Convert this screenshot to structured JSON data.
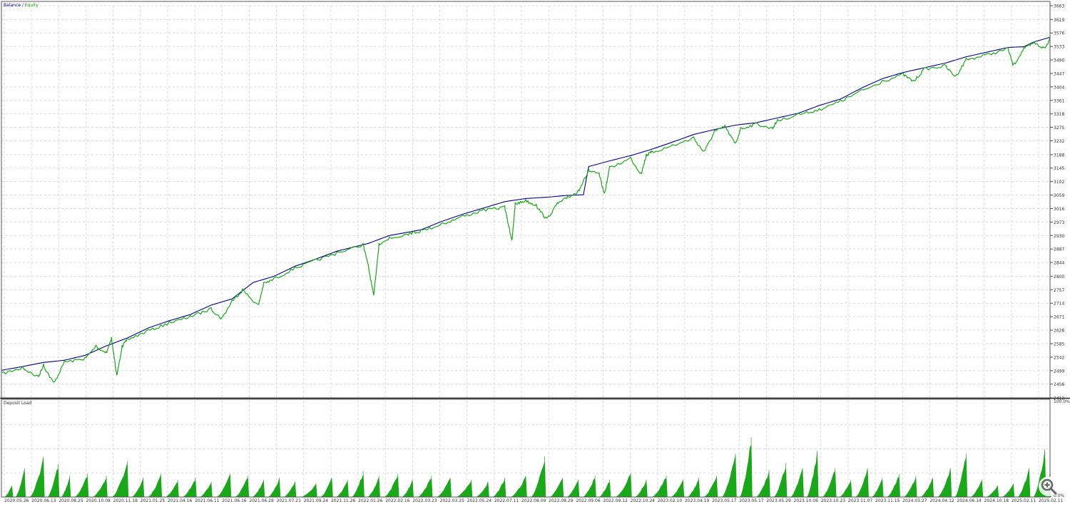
{
  "chart_data": [
    {
      "type": "line",
      "title": "Balance / Equity",
      "legend": [
        {
          "name": "Balance",
          "color": "#00008b"
        },
        {
          "name": "Equity",
          "color": "#18a818"
        }
      ],
      "separator": " / ",
      "ylim": [
        2412,
        3663
      ],
      "y_ticks": [
        3663,
        3619,
        3576,
        3533,
        3490,
        3447,
        3404,
        3361,
        3318,
        3275,
        3232,
        3188,
        3145,
        3102,
        3059,
        3016,
        2973,
        2930,
        2887,
        2844,
        2800,
        2757,
        2714,
        2671,
        2628,
        2585,
        2542,
        2499,
        2456,
        2412
      ],
      "grid": true,
      "series": [
        {
          "name": "Balance",
          "color": "#00008b",
          "points": [
            [
              0,
              2500
            ],
            [
              0.02,
              2512
            ],
            [
              0.04,
              2525
            ],
            [
              0.06,
              2532
            ],
            [
              0.08,
              2548
            ],
            [
              0.1,
              2578
            ],
            [
              0.12,
              2603
            ],
            [
              0.14,
              2635
            ],
            [
              0.16,
              2658
            ],
            [
              0.18,
              2678
            ],
            [
              0.2,
              2708
            ],
            [
              0.22,
              2728
            ],
            [
              0.24,
              2780
            ],
            [
              0.26,
              2800
            ],
            [
              0.28,
              2832
            ],
            [
              0.3,
              2855
            ],
            [
              0.32,
              2880
            ],
            [
              0.35,
              2905
            ],
            [
              0.37,
              2930
            ],
            [
              0.4,
              2948
            ],
            [
              0.42,
              2975
            ],
            [
              0.44,
              2998
            ],
            [
              0.46,
              3018
            ],
            [
              0.48,
              3038
            ],
            [
              0.5,
              3048
            ],
            [
              0.52,
              3052
            ],
            [
              0.54,
              3058
            ],
            [
              0.555,
              3060
            ],
            [
              0.56,
              3150
            ],
            [
              0.58,
              3168
            ],
            [
              0.6,
              3185
            ],
            [
              0.62,
              3205
            ],
            [
              0.64,
              3228
            ],
            [
              0.66,
              3252
            ],
            [
              0.68,
              3268
            ],
            [
              0.7,
              3282
            ],
            [
              0.72,
              3290
            ],
            [
              0.74,
              3305
            ],
            [
              0.76,
              3320
            ],
            [
              0.78,
              3345
            ],
            [
              0.8,
              3365
            ],
            [
              0.82,
              3400
            ],
            [
              0.84,
              3430
            ],
            [
              0.86,
              3450
            ],
            [
              0.88,
              3465
            ],
            [
              0.9,
              3480
            ],
            [
              0.92,
              3500
            ],
            [
              0.94,
              3515
            ],
            [
              0.96,
              3530
            ],
            [
              0.975,
              3532
            ],
            [
              0.985,
              3548
            ],
            [
              1.0,
              3562
            ]
          ]
        },
        {
          "name": "Equity",
          "color": "#18a818",
          "points": [
            [
              0,
              2493
            ],
            [
              0.02,
              2512
            ],
            [
              0.035,
              2482
            ],
            [
              0.04,
              2520
            ],
            [
              0.05,
              2462
            ],
            [
              0.06,
              2530
            ],
            [
              0.08,
              2542
            ],
            [
              0.09,
              2580
            ],
            [
              0.1,
              2560
            ],
            [
              0.105,
              2605
            ],
            [
              0.11,
              2485
            ],
            [
              0.115,
              2580
            ],
            [
              0.12,
              2602
            ],
            [
              0.14,
              2630
            ],
            [
              0.16,
              2655
            ],
            [
              0.18,
              2675
            ],
            [
              0.2,
              2700
            ],
            [
              0.21,
              2668
            ],
            [
              0.22,
              2725
            ],
            [
              0.23,
              2760
            ],
            [
              0.245,
              2710
            ],
            [
              0.25,
              2780
            ],
            [
              0.26,
              2795
            ],
            [
              0.28,
              2830
            ],
            [
              0.3,
              2855
            ],
            [
              0.32,
              2878
            ],
            [
              0.345,
              2905
            ],
            [
              0.35,
              2835
            ],
            [
              0.355,
              2740
            ],
            [
              0.36,
              2905
            ],
            [
              0.37,
              2925
            ],
            [
              0.39,
              2942
            ],
            [
              0.4,
              2948
            ],
            [
              0.42,
              2970
            ],
            [
              0.44,
              2995
            ],
            [
              0.46,
              3015
            ],
            [
              0.48,
              3025
            ],
            [
              0.484,
              2960
            ],
            [
              0.487,
              2918
            ],
            [
              0.49,
              3035
            ],
            [
              0.5,
              3045
            ],
            [
              0.51,
              3030
            ],
            [
              0.52,
              2985
            ],
            [
              0.53,
              3035
            ],
            [
              0.54,
              3055
            ],
            [
              0.55,
              3075
            ],
            [
              0.56,
              3140
            ],
            [
              0.57,
              3130
            ],
            [
              0.575,
              3065
            ],
            [
              0.58,
              3150
            ],
            [
              0.6,
              3180
            ],
            [
              0.61,
              3130
            ],
            [
              0.615,
              3190
            ],
            [
              0.62,
              3200
            ],
            [
              0.64,
              3220
            ],
            [
              0.66,
              3245
            ],
            [
              0.67,
              3200
            ],
            [
              0.68,
              3265
            ],
            [
              0.69,
              3282
            ],
            [
              0.7,
              3225
            ],
            [
              0.705,
              3275
            ],
            [
              0.72,
              3290
            ],
            [
              0.735,
              3275
            ],
            [
              0.74,
              3300
            ],
            [
              0.76,
              3320
            ],
            [
              0.78,
              3335
            ],
            [
              0.8,
              3362
            ],
            [
              0.82,
              3395
            ],
            [
              0.84,
              3425
            ],
            [
              0.86,
              3448
            ],
            [
              0.87,
              3425
            ],
            [
              0.88,
              3465
            ],
            [
              0.9,
              3475
            ],
            [
              0.91,
              3440
            ],
            [
              0.92,
              3495
            ],
            [
              0.94,
              3510
            ],
            [
              0.96,
              3530
            ],
            [
              0.965,
              3475
            ],
            [
              0.975,
              3530
            ],
            [
              0.985,
              3548
            ],
            [
              0.995,
              3530
            ],
            [
              1.0,
              3562
            ]
          ]
        }
      ]
    },
    {
      "type": "area",
      "title": "Deposit Load",
      "ylim": [
        0,
        100
      ],
      "y_top_label": "100.0%",
      "y_bottom_label": "0.0%",
      "color": "#18a818",
      "peaks": [
        [
          0.01,
          12
        ],
        [
          0.022,
          30
        ],
        [
          0.04,
          42
        ],
        [
          0.054,
          34
        ],
        [
          0.065,
          22
        ],
        [
          0.082,
          24
        ],
        [
          0.1,
          22
        ],
        [
          0.12,
          37
        ],
        [
          0.135,
          20
        ],
        [
          0.152,
          24
        ],
        [
          0.168,
          18
        ],
        [
          0.185,
          20
        ],
        [
          0.2,
          16
        ],
        [
          0.218,
          24
        ],
        [
          0.235,
          22
        ],
        [
          0.25,
          18
        ],
        [
          0.265,
          20
        ],
        [
          0.28,
          16
        ],
        [
          0.3,
          14
        ],
        [
          0.315,
          20
        ],
        [
          0.33,
          18
        ],
        [
          0.345,
          27
        ],
        [
          0.36,
          22
        ],
        [
          0.378,
          24
        ],
        [
          0.392,
          18
        ],
        [
          0.41,
          22
        ],
        [
          0.428,
          20
        ],
        [
          0.448,
          18
        ],
        [
          0.464,
          16
        ],
        [
          0.48,
          20
        ],
        [
          0.5,
          22
        ],
        [
          0.518,
          42
        ],
        [
          0.535,
          20
        ],
        [
          0.55,
          18
        ],
        [
          0.566,
          22
        ],
        [
          0.58,
          18
        ],
        [
          0.6,
          25
        ],
        [
          0.615,
          18
        ],
        [
          0.634,
          22
        ],
        [
          0.65,
          18
        ],
        [
          0.665,
          20
        ],
        [
          0.682,
          22
        ],
        [
          0.7,
          45
        ],
        [
          0.715,
          62
        ],
        [
          0.732,
          28
        ],
        [
          0.748,
          35
        ],
        [
          0.764,
          30
        ],
        [
          0.778,
          48
        ],
        [
          0.795,
          30
        ],
        [
          0.81,
          18
        ],
        [
          0.826,
          30
        ],
        [
          0.84,
          20
        ],
        [
          0.856,
          24
        ],
        [
          0.872,
          22
        ],
        [
          0.888,
          20
        ],
        [
          0.905,
          30
        ],
        [
          0.92,
          45
        ],
        [
          0.935,
          18
        ],
        [
          0.95,
          12
        ],
        [
          0.965,
          14
        ],
        [
          0.98,
          30
        ],
        [
          0.995,
          50
        ],
        [
          1.0,
          30
        ]
      ],
      "x_ticks": [
        "2020.05.26",
        "2020.06.13",
        "2020.08.25",
        "2020.10.08",
        "2020.11.18",
        "2021.01.25",
        "2021.04.16",
        "2021.06.11",
        "2021.06.16",
        "2021.06.28",
        "2021.07.21",
        "2021.09.24",
        "2021.11.26",
        "2022.01.26",
        "2022.02.16",
        "2022.03.23",
        "2022.03.25",
        "2022.05.24",
        "2022.07.11",
        "2022.08.09",
        "2022.08.29",
        "2022.09.06",
        "2022.09.12",
        "2022.10.24",
        "2023.02.10",
        "2023.04.19",
        "2023.05.17",
        "2023.05.17",
        "2023.05.29",
        "2023.10.06",
        "2023.10.23",
        "2023.11.07",
        "2023.11.15",
        "2024.03.27",
        "2024.04.12",
        "2024.06.14",
        "2024.10.18",
        "2025.02.11",
        "2025.02.11"
      ]
    }
  ],
  "ui": {
    "zoom_icon": "magnifier-plus-icon"
  }
}
